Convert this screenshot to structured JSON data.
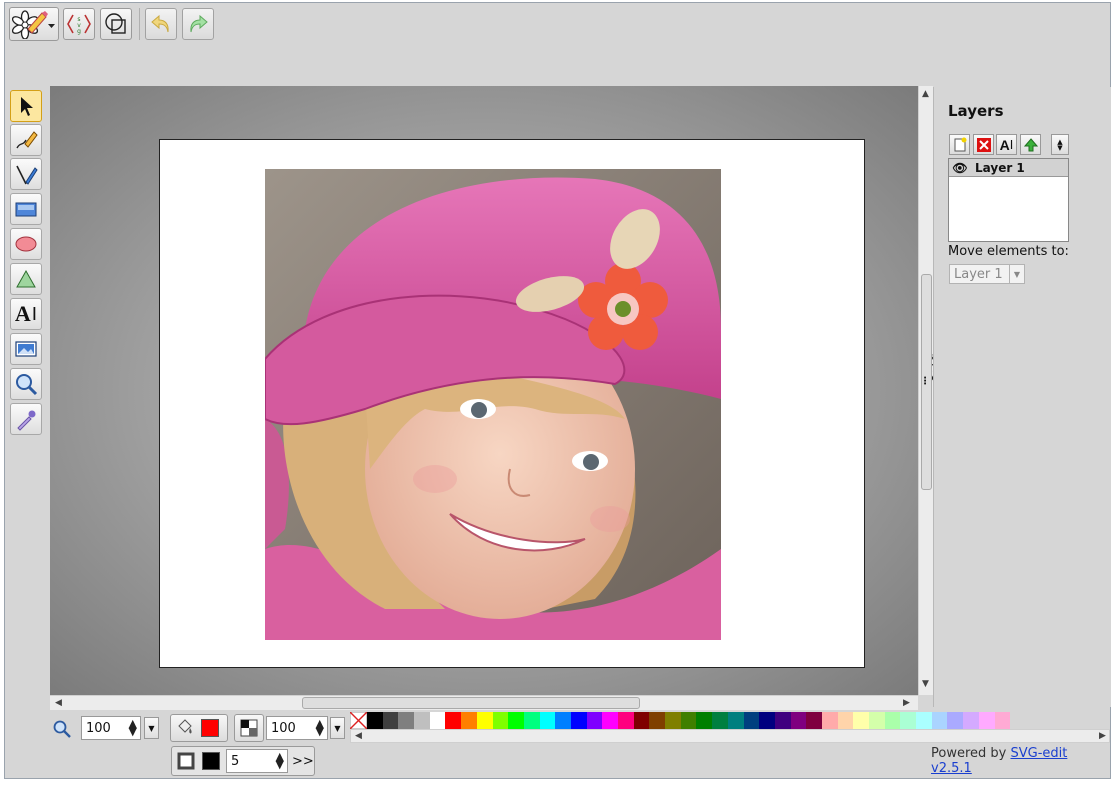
{
  "toolbar": {
    "main_menu_icon": "svg-edit-logo-icon",
    "source_icon": "svg-source-icon",
    "wireframe_icon": "wireframe-icon",
    "undo_icon": "undo-icon",
    "redo_icon": "redo-icon"
  },
  "tools": [
    {
      "name": "select-tool",
      "icon": "pointer-arrow-icon",
      "active": true
    },
    {
      "name": "pencil-tool",
      "icon": "pencil-icon"
    },
    {
      "name": "line-tool",
      "icon": "pen-line-icon"
    },
    {
      "name": "rect-tool",
      "icon": "rectangle-icon"
    },
    {
      "name": "ellipse-tool",
      "icon": "ellipse-icon"
    },
    {
      "name": "path-tool",
      "icon": "polygon-icon"
    },
    {
      "name": "text-tool",
      "icon": "text-icon",
      "label": "A"
    },
    {
      "name": "image-tool",
      "icon": "image-icon"
    },
    {
      "name": "zoom-tool",
      "icon": "magnifier-icon"
    },
    {
      "name": "eyedropper-tool",
      "icon": "eyedropper-icon"
    }
  ],
  "canvas": {
    "image_icon": "photo-of-girl-in-pink-cap"
  },
  "layers": {
    "tab_label": "Layers",
    "title": "Layers",
    "items": [
      {
        "label": "Layer 1",
        "visible": true
      }
    ],
    "move_label": "Move elements to:",
    "move_value": "Layer 1"
  },
  "bottom": {
    "zoom_value": "100",
    "fill_color": "#ff0000",
    "opacity_value": "100",
    "stroke_color": "#000000",
    "stroke_width": "5",
    "more_label": ">>",
    "powered_prefix": "Powered by ",
    "powered_link": "SVG-edit v2.5.1"
  },
  "palette": [
    "#000000",
    "#3f3f3f",
    "#7f7f7f",
    "#bfbfbf",
    "#ffffff",
    "#ff0000",
    "#ff7f00",
    "#ffff00",
    "#7fff00",
    "#00ff00",
    "#00ff7f",
    "#00ffff",
    "#007fff",
    "#0000ff",
    "#7f00ff",
    "#ff00ff",
    "#ff007f",
    "#7f0000",
    "#7f3f00",
    "#7f7f00",
    "#3f7f00",
    "#007f00",
    "#007f3f",
    "#007f7f",
    "#003f7f",
    "#00007f",
    "#3f007f",
    "#7f007f",
    "#7f003f",
    "#ffaaaa",
    "#ffd4aa",
    "#ffffaa",
    "#d4ffaa",
    "#aaffaa",
    "#aaffd4",
    "#aaffff",
    "#aad4ff",
    "#aaaaff",
    "#d4aaff",
    "#ffaaff",
    "#ffaad4"
  ]
}
